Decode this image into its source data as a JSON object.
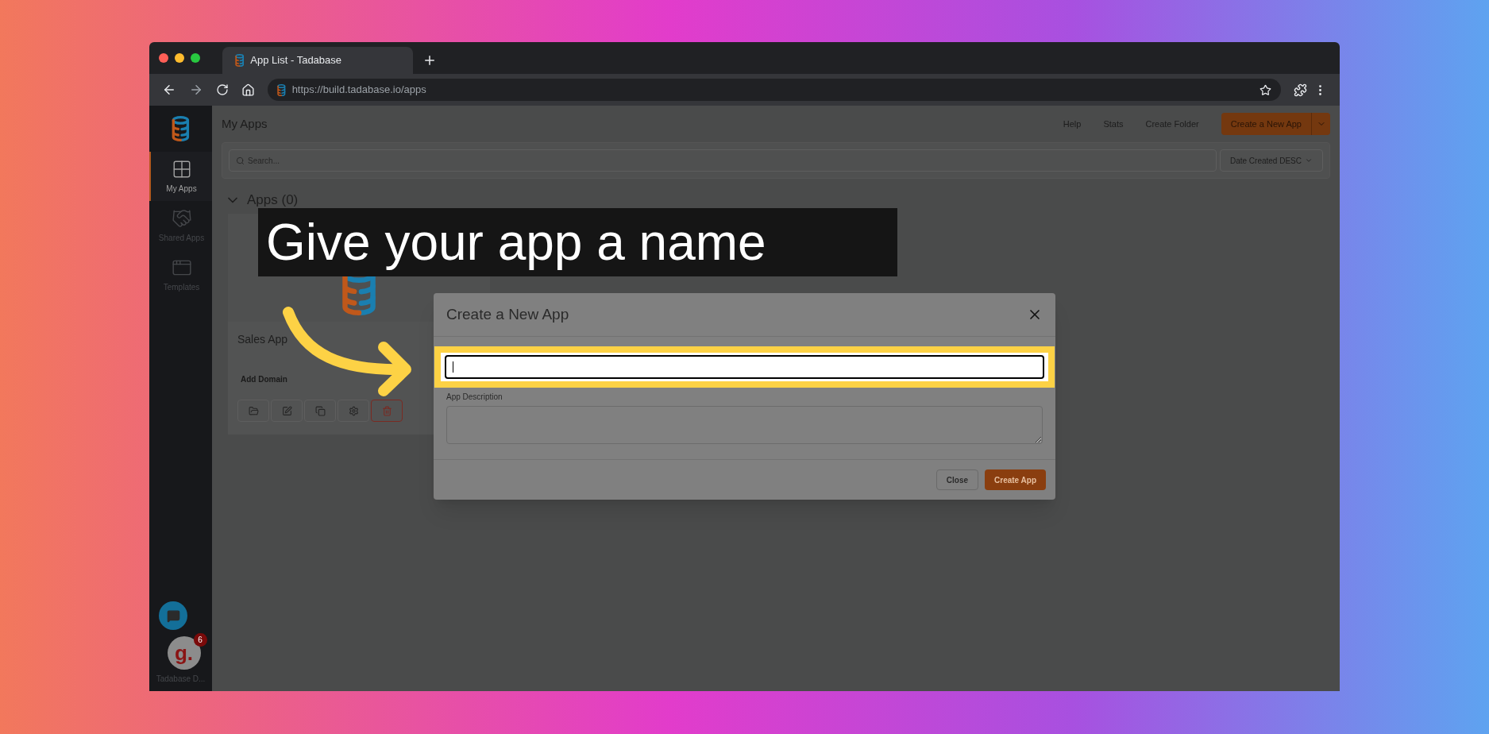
{
  "caption": {
    "text": "Give your app a name"
  },
  "browser": {
    "tabs": [
      {
        "title": "App List - Tadabase",
        "selected": true
      }
    ],
    "url": "https://build.tadabase.io/apps"
  },
  "sidebar": {
    "items": [
      {
        "label": "My Apps",
        "selected": true
      },
      {
        "label": "Shared Apps",
        "selected": false
      },
      {
        "label": "Templates",
        "selected": false
      }
    ],
    "help_widget": {
      "glyph": "g.",
      "badge": "6"
    },
    "user_label": "Tadabase D..."
  },
  "header": {
    "title": "My Apps",
    "links": [
      "Help",
      "Stats",
      "Create Folder"
    ],
    "primary_button": "Create a New App"
  },
  "search": {
    "placeholder": "Search..."
  },
  "sort": {
    "label": "Date Created DESC"
  },
  "apps_section": {
    "title": "Apps (0)",
    "expanded": true
  },
  "app_cards": [
    {
      "name": "Sales App",
      "domain_link": "Add Domain",
      "actions": [
        {
          "kind": "open"
        },
        {
          "kind": "edit"
        },
        {
          "kind": "copy"
        },
        {
          "kind": "settings"
        },
        {
          "kind": "delete"
        }
      ]
    }
  ],
  "modal": {
    "title": "Create a New App",
    "fields": [
      {
        "kind": "input",
        "highlighted": true,
        "focused": true
      },
      {
        "kind": "textarea",
        "label": "App Description",
        "highlighted": false,
        "focused": false
      }
    ],
    "buttons": [
      {
        "label": "Close",
        "kind": "secondary"
      },
      {
        "label": "Create App",
        "kind": "primary"
      }
    ]
  }
}
